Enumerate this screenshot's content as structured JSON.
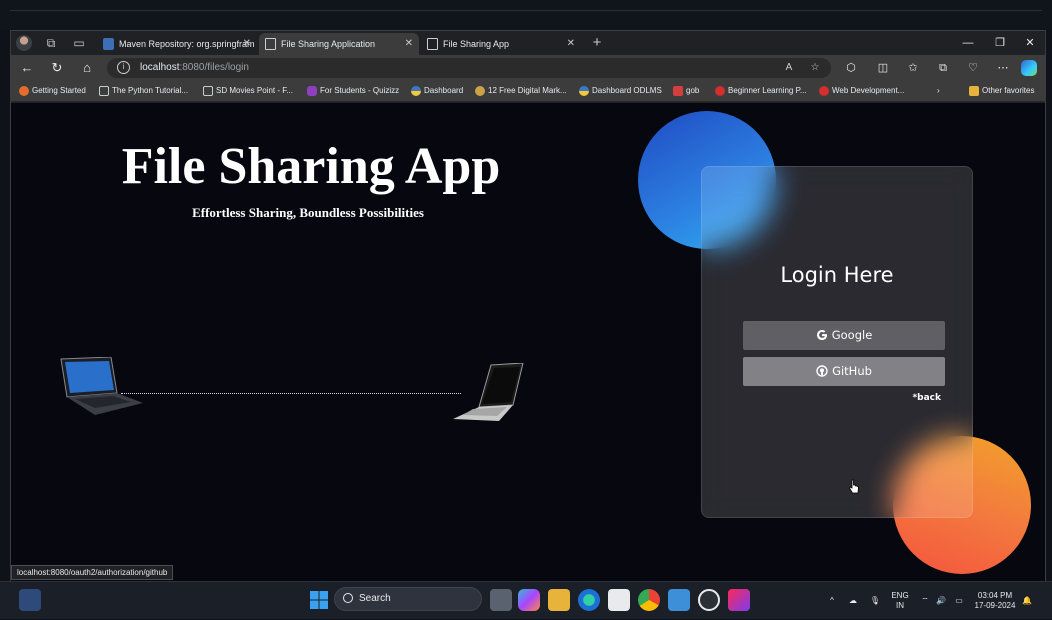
{
  "browser": {
    "tabs": [
      {
        "title": "Maven Repository: org.springfram",
        "active": false
      },
      {
        "title": "File Sharing Application",
        "active": true
      },
      {
        "title": "File Sharing App",
        "active": false
      }
    ],
    "new_tab": "+",
    "address": {
      "host": "localhost",
      "rest": ":8080/files/login"
    },
    "bookmarks": [
      "Getting Started",
      "The Python Tutorial...",
      "SD Movies Point - F...",
      "For Students - Quizizz",
      "Dashboard",
      "12 Free Digital Mark...",
      "Dashboard ODLMS",
      "gob",
      "Beginner Learning P...",
      "Web Development..."
    ],
    "other_favorites": "Other favorites",
    "status_url": "localhost:8080/oauth2/authorization/github"
  },
  "page": {
    "title": "File Sharing App",
    "subtitle": "Effortless Sharing, Boundless Possibilities",
    "login": {
      "heading": "Login Here",
      "google_label": "Google",
      "github_label": "GitHub",
      "back_label": "*back"
    }
  },
  "taskbar": {
    "search_label": "Search",
    "lang": "ENG",
    "region": "IN",
    "time": "03:04 PM",
    "date": "17-09-2024"
  },
  "colors": {
    "page_bg": "#07070f",
    "blue_blob": "#2c7de0",
    "orange_blob": "#f37a3e"
  }
}
